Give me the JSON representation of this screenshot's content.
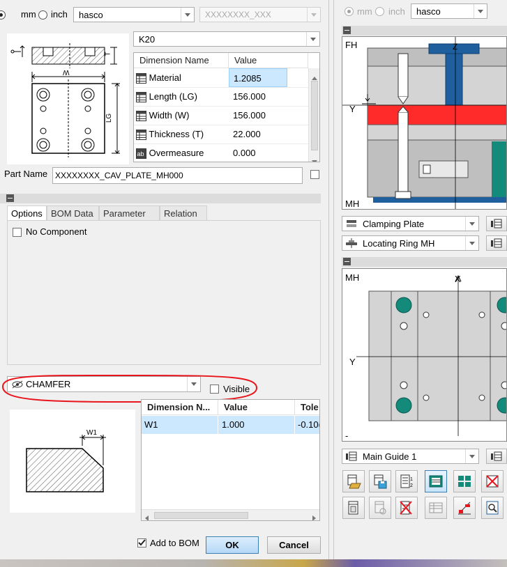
{
  "units": {
    "mm": "mm",
    "inch": "inch",
    "selected": "mm"
  },
  "catalog": {
    "value": "hasco",
    "article": "XXXXXXXX_XXX"
  },
  "type_select": "K20",
  "dim_table": {
    "headers": [
      "Dimension Name",
      "Value"
    ],
    "rows": [
      {
        "name": "Material",
        "value": "1.2085",
        "icon": "table-icon"
      },
      {
        "name": "Length (LG)",
        "value": "156.000",
        "icon": "table-icon"
      },
      {
        "name": "Width (W)",
        "value": "156.000",
        "icon": "table-icon"
      },
      {
        "name": "Thickness (T)",
        "value": "22.000",
        "icon": "table-icon"
      },
      {
        "name": "Overmeasure",
        "value": "0.000",
        "icon": "text-field-icon"
      }
    ]
  },
  "sketch_labels": {
    "w": "W",
    "lg": "LG",
    "t": "T"
  },
  "part_name": {
    "label": "Part Name",
    "value": "XXXXXXXX_CAV_PLATE_MH000"
  },
  "tabs": [
    "Options",
    "BOM Data",
    "Parameter",
    "Relation"
  ],
  "options": {
    "no_component": "No Component"
  },
  "feature": {
    "select": "CHAMFER",
    "visible": "Visible",
    "w1": "W1"
  },
  "feature_table": {
    "headers": [
      "Dimension N...",
      "Value",
      "Tole"
    ],
    "row": {
      "name": "W1",
      "value": "1.000",
      "tol": "-0.10("
    }
  },
  "footer": {
    "add_to_bom": "Add to BOM",
    "ok": "OK",
    "cancel": "Cancel"
  },
  "right": {
    "units": {
      "mm": "mm",
      "inch": "inch"
    },
    "catalog": "hasco",
    "fh": "FH",
    "mh": "MH",
    "z": "Z",
    "y": "Y",
    "x": "X",
    "mh2": "MH",
    "dash": "-",
    "selects": [
      "Clamping Plate",
      "Locating Ring MH",
      "Main Guide 1"
    ]
  },
  "colors": {
    "selection": "#cce8ff",
    "plate_red": "#ff2a2a",
    "plate_blue": "#1f5f9e",
    "teal": "#138a7a",
    "annotation": "#e8151d"
  }
}
